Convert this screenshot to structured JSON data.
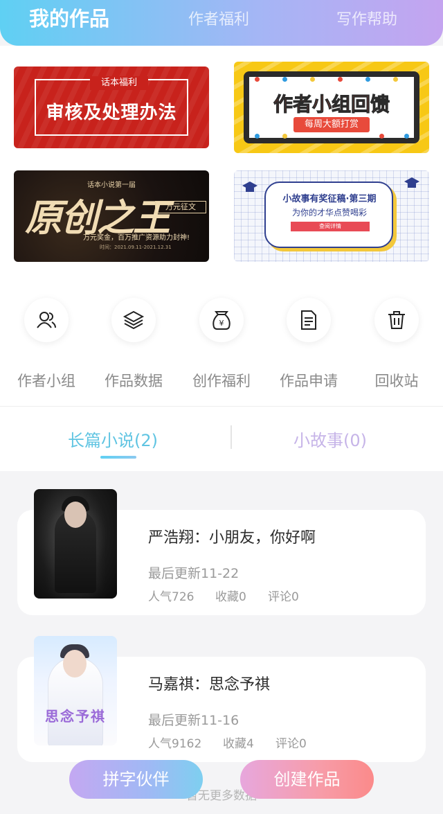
{
  "header": {
    "tabs": [
      {
        "label": "我的作品",
        "active": true
      },
      {
        "label": "作者福利",
        "active": false
      },
      {
        "label": "写作帮助",
        "active": false
      }
    ]
  },
  "banners": {
    "b1": {
      "tag": "话本福利",
      "title": "审核及处理办法"
    },
    "b2": {
      "title": "作者小组回馈",
      "sub": "每周大额打赏"
    },
    "b3": {
      "top": "话本小说第一届",
      "title": "原创之王",
      "prize": "万元征文",
      "slogan": "万元奖金，百万推广资源助力封神!",
      "date": "时间：2021.09.11-2021.12.31"
    },
    "b4": {
      "title": "小故事有奖征稿·第三期",
      "sub": "为你的才华点赞喝彩",
      "button": "查阅详情"
    }
  },
  "menu": [
    {
      "label": "作者小组",
      "icon": "users-icon"
    },
    {
      "label": "作品数据",
      "icon": "layers-icon"
    },
    {
      "label": "创作福利",
      "icon": "money-bag-icon"
    },
    {
      "label": "作品申请",
      "icon": "document-icon"
    },
    {
      "label": "回收站",
      "icon": "trash-icon"
    }
  ],
  "novel_tabs": [
    {
      "label": "长篇小说(2)",
      "active": true
    },
    {
      "label": "小故事(0)",
      "active": false
    }
  ],
  "works": [
    {
      "title": "严浩翔：小朋友，你好啊",
      "updated": "最后更新11-22",
      "popularity": "人气726",
      "favorites": "收藏0",
      "comments": "评论0"
    },
    {
      "title": "马嘉祺：思念予祺",
      "updated": "最后更新11-16",
      "popularity": "人气9162",
      "favorites": "收藏4",
      "comments": "评论0",
      "cover_text": "思念予祺"
    }
  ],
  "footer": {
    "no_more": "暂无更多数据",
    "btn_partner": "拼字伙伴",
    "btn_create": "创建作品"
  },
  "colors": {
    "header_start": "#5fd0f3",
    "header_end": "#c4a4f0",
    "active_tab": "#5fc4e2",
    "inactive_tab": "#c6b4e8"
  }
}
